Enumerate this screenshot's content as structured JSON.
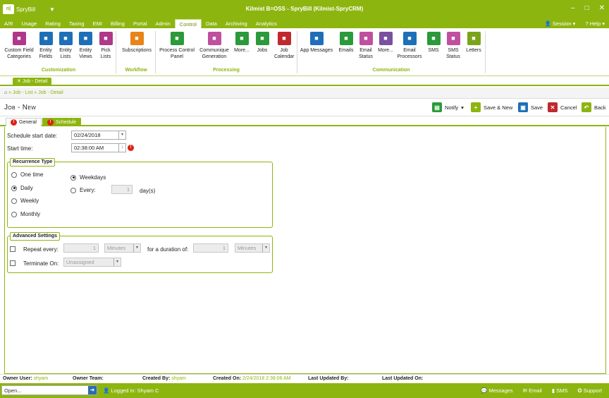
{
  "app": {
    "logo": "SpryBill",
    "window_title": "Kilmist  B=OSS - SpryBill (Kilmist-SpryCRM)",
    "qat": "▼"
  },
  "menu": {
    "items": [
      "A/R",
      "Usage",
      "Rating",
      "Taxing",
      "EMI",
      "Billing",
      "Portal",
      "Admin",
      "Control",
      "Data",
      "Archiving",
      "Analytics"
    ],
    "active": "Control",
    "session": "Session",
    "help": "Help"
  },
  "ribbon": {
    "groups": {
      "customization": "Customization",
      "workflow": "Workflow",
      "processing": "Processing",
      "communication": "Communication"
    },
    "buttons": [
      {
        "label": "Custom Field\nCategories",
        "color": "#b0378a",
        "icon": "custom-field-categories-icon"
      },
      {
        "label": "Entity\nFields",
        "color": "#1e6fb8",
        "icon": "entity-fields-icon"
      },
      {
        "label": "Entity\nLists",
        "color": "#1e6fb8",
        "icon": "entity-lists-icon"
      },
      {
        "label": "Entity\nViews",
        "color": "#1e6fb8",
        "icon": "entity-views-icon"
      },
      {
        "label": "Pick\nLists",
        "color": "#b0378a",
        "icon": "pick-lists-icon"
      },
      {
        "label": "Subscriptions",
        "color": "#e8841a",
        "icon": "rss-icon"
      },
      {
        "label": "Process Control\nPanel",
        "color": "#2a9a3a",
        "icon": "process-control-icon"
      },
      {
        "label": "Communique\nGeneration",
        "color": "#c04fa0",
        "icon": "communique-icon"
      },
      {
        "label": "More...",
        "color": "#2a9a3a",
        "icon": "more-icon"
      },
      {
        "label": "Jobs",
        "color": "#2a9a3a",
        "icon": "jobs-clock-icon"
      },
      {
        "label": "Job\nCalendar",
        "color": "#c0282e",
        "icon": "calendar-icon"
      },
      {
        "label": "App Messages",
        "color": "#1e6fb8",
        "icon": "app-messages-icon"
      },
      {
        "label": "Emails",
        "color": "#2a9a3a",
        "icon": "email-icon"
      },
      {
        "label": "Email\nStatus",
        "color": "#c04fa0",
        "icon": "email-status-icon"
      },
      {
        "label": "More...",
        "color": "#7a4fa0",
        "icon": "more-icon"
      },
      {
        "label": "Email\nProcessors",
        "color": "#1e6fb8",
        "icon": "email-processors-icon"
      },
      {
        "label": "SMS",
        "color": "#2a9a3a",
        "icon": "sms-icon"
      },
      {
        "label": "SMS\nStatus",
        "color": "#c04fa0",
        "icon": "sms-status-icon"
      },
      {
        "label": "Letters",
        "color": "#7aa51a",
        "icon": "letters-icon"
      }
    ]
  },
  "doc_tab": "Job - Detail",
  "breadcrumb": {
    "part1": "Job - List",
    "part2": "Job - Detail"
  },
  "page": {
    "title": "Job - New"
  },
  "toolbar": {
    "notify": "Notify",
    "save_new": "Save & New",
    "save": "Save",
    "cancel": "Cancel",
    "back": "Back"
  },
  "subtabs": {
    "general": "General",
    "schedule": "Schedule"
  },
  "form": {
    "start_date_label": "Schedule start date:",
    "start_date": "02/24/2018",
    "start_time_label": "Start time:",
    "start_time": "02:38:00 AM",
    "recurrence": {
      "legend": "Recurrence Type",
      "one_time": "One time",
      "daily": "Daily",
      "weekly": "Weekly",
      "monthly": "Monthly",
      "weekdays": "Weekdays",
      "every": "Every:",
      "every_value": "1",
      "days": "day(s)"
    },
    "advanced": {
      "legend": "Advanced Settings",
      "repeat_every": "Repeat every:",
      "repeat_value": "1",
      "repeat_unit": "Minutes",
      "duration_label": "for a duration of:",
      "duration_value": "1",
      "duration_unit": "Minutes",
      "terminate": "Terminate On:",
      "terminate_value": "Unassigned"
    }
  },
  "footer": {
    "owner_user_label": "Owner User:",
    "owner_user": "shyam",
    "owner_team_label": "Owner Team:",
    "created_by_label": "Created By:",
    "created_by": "shyam",
    "created_on_label": "Created On:",
    "created_on": "2/24/2018 2:38:06 AM",
    "last_updated_by_label": "Last Updated By:",
    "last_updated_on_label": "Last Updated On:"
  },
  "status": {
    "open_placeholder": "Open...",
    "logged_in": "Logged in: Shyam C",
    "messages": "Messages",
    "email": "Email",
    "sms": "SMS",
    "support": "Support"
  }
}
